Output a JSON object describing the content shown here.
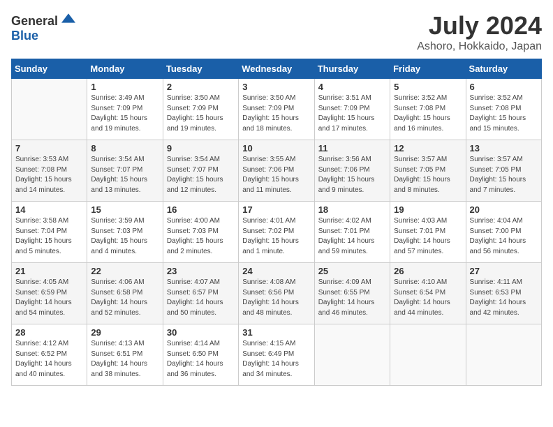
{
  "logo": {
    "general": "General",
    "blue": "Blue"
  },
  "title": "July 2024",
  "location": "Ashoro, Hokkaido, Japan",
  "weekdays": [
    "Sunday",
    "Monday",
    "Tuesday",
    "Wednesday",
    "Thursday",
    "Friday",
    "Saturday"
  ],
  "weeks": [
    [
      {
        "day": "",
        "sunrise": "",
        "sunset": "",
        "daylight": ""
      },
      {
        "day": "1",
        "sunrise": "Sunrise: 3:49 AM",
        "sunset": "Sunset: 7:09 PM",
        "daylight": "Daylight: 15 hours and 19 minutes."
      },
      {
        "day": "2",
        "sunrise": "Sunrise: 3:50 AM",
        "sunset": "Sunset: 7:09 PM",
        "daylight": "Daylight: 15 hours and 19 minutes."
      },
      {
        "day": "3",
        "sunrise": "Sunrise: 3:50 AM",
        "sunset": "Sunset: 7:09 PM",
        "daylight": "Daylight: 15 hours and 18 minutes."
      },
      {
        "day": "4",
        "sunrise": "Sunrise: 3:51 AM",
        "sunset": "Sunset: 7:09 PM",
        "daylight": "Daylight: 15 hours and 17 minutes."
      },
      {
        "day": "5",
        "sunrise": "Sunrise: 3:52 AM",
        "sunset": "Sunset: 7:08 PM",
        "daylight": "Daylight: 15 hours and 16 minutes."
      },
      {
        "day": "6",
        "sunrise": "Sunrise: 3:52 AM",
        "sunset": "Sunset: 7:08 PM",
        "daylight": "Daylight: 15 hours and 15 minutes."
      }
    ],
    [
      {
        "day": "7",
        "sunrise": "Sunrise: 3:53 AM",
        "sunset": "Sunset: 7:08 PM",
        "daylight": "Daylight: 15 hours and 14 minutes."
      },
      {
        "day": "8",
        "sunrise": "Sunrise: 3:54 AM",
        "sunset": "Sunset: 7:07 PM",
        "daylight": "Daylight: 15 hours and 13 minutes."
      },
      {
        "day": "9",
        "sunrise": "Sunrise: 3:54 AM",
        "sunset": "Sunset: 7:07 PM",
        "daylight": "Daylight: 15 hours and 12 minutes."
      },
      {
        "day": "10",
        "sunrise": "Sunrise: 3:55 AM",
        "sunset": "Sunset: 7:06 PM",
        "daylight": "Daylight: 15 hours and 11 minutes."
      },
      {
        "day": "11",
        "sunrise": "Sunrise: 3:56 AM",
        "sunset": "Sunset: 7:06 PM",
        "daylight": "Daylight: 15 hours and 9 minutes."
      },
      {
        "day": "12",
        "sunrise": "Sunrise: 3:57 AM",
        "sunset": "Sunset: 7:05 PM",
        "daylight": "Daylight: 15 hours and 8 minutes."
      },
      {
        "day": "13",
        "sunrise": "Sunrise: 3:57 AM",
        "sunset": "Sunset: 7:05 PM",
        "daylight": "Daylight: 15 hours and 7 minutes."
      }
    ],
    [
      {
        "day": "14",
        "sunrise": "Sunrise: 3:58 AM",
        "sunset": "Sunset: 7:04 PM",
        "daylight": "Daylight: 15 hours and 5 minutes."
      },
      {
        "day": "15",
        "sunrise": "Sunrise: 3:59 AM",
        "sunset": "Sunset: 7:03 PM",
        "daylight": "Daylight: 15 hours and 4 minutes."
      },
      {
        "day": "16",
        "sunrise": "Sunrise: 4:00 AM",
        "sunset": "Sunset: 7:03 PM",
        "daylight": "Daylight: 15 hours and 2 minutes."
      },
      {
        "day": "17",
        "sunrise": "Sunrise: 4:01 AM",
        "sunset": "Sunset: 7:02 PM",
        "daylight": "Daylight: 15 hours and 1 minute."
      },
      {
        "day": "18",
        "sunrise": "Sunrise: 4:02 AM",
        "sunset": "Sunset: 7:01 PM",
        "daylight": "Daylight: 14 hours and 59 minutes."
      },
      {
        "day": "19",
        "sunrise": "Sunrise: 4:03 AM",
        "sunset": "Sunset: 7:01 PM",
        "daylight": "Daylight: 14 hours and 57 minutes."
      },
      {
        "day": "20",
        "sunrise": "Sunrise: 4:04 AM",
        "sunset": "Sunset: 7:00 PM",
        "daylight": "Daylight: 14 hours and 56 minutes."
      }
    ],
    [
      {
        "day": "21",
        "sunrise": "Sunrise: 4:05 AM",
        "sunset": "Sunset: 6:59 PM",
        "daylight": "Daylight: 14 hours and 54 minutes."
      },
      {
        "day": "22",
        "sunrise": "Sunrise: 4:06 AM",
        "sunset": "Sunset: 6:58 PM",
        "daylight": "Daylight: 14 hours and 52 minutes."
      },
      {
        "day": "23",
        "sunrise": "Sunrise: 4:07 AM",
        "sunset": "Sunset: 6:57 PM",
        "daylight": "Daylight: 14 hours and 50 minutes."
      },
      {
        "day": "24",
        "sunrise": "Sunrise: 4:08 AM",
        "sunset": "Sunset: 6:56 PM",
        "daylight": "Daylight: 14 hours and 48 minutes."
      },
      {
        "day": "25",
        "sunrise": "Sunrise: 4:09 AM",
        "sunset": "Sunset: 6:55 PM",
        "daylight": "Daylight: 14 hours and 46 minutes."
      },
      {
        "day": "26",
        "sunrise": "Sunrise: 4:10 AM",
        "sunset": "Sunset: 6:54 PM",
        "daylight": "Daylight: 14 hours and 44 minutes."
      },
      {
        "day": "27",
        "sunrise": "Sunrise: 4:11 AM",
        "sunset": "Sunset: 6:53 PM",
        "daylight": "Daylight: 14 hours and 42 minutes."
      }
    ],
    [
      {
        "day": "28",
        "sunrise": "Sunrise: 4:12 AM",
        "sunset": "Sunset: 6:52 PM",
        "daylight": "Daylight: 14 hours and 40 minutes."
      },
      {
        "day": "29",
        "sunrise": "Sunrise: 4:13 AM",
        "sunset": "Sunset: 6:51 PM",
        "daylight": "Daylight: 14 hours and 38 minutes."
      },
      {
        "day": "30",
        "sunrise": "Sunrise: 4:14 AM",
        "sunset": "Sunset: 6:50 PM",
        "daylight": "Daylight: 14 hours and 36 minutes."
      },
      {
        "day": "31",
        "sunrise": "Sunrise: 4:15 AM",
        "sunset": "Sunset: 6:49 PM",
        "daylight": "Daylight: 14 hours and 34 minutes."
      },
      {
        "day": "",
        "sunrise": "",
        "sunset": "",
        "daylight": ""
      },
      {
        "day": "",
        "sunrise": "",
        "sunset": "",
        "daylight": ""
      },
      {
        "day": "",
        "sunrise": "",
        "sunset": "",
        "daylight": ""
      }
    ]
  ]
}
